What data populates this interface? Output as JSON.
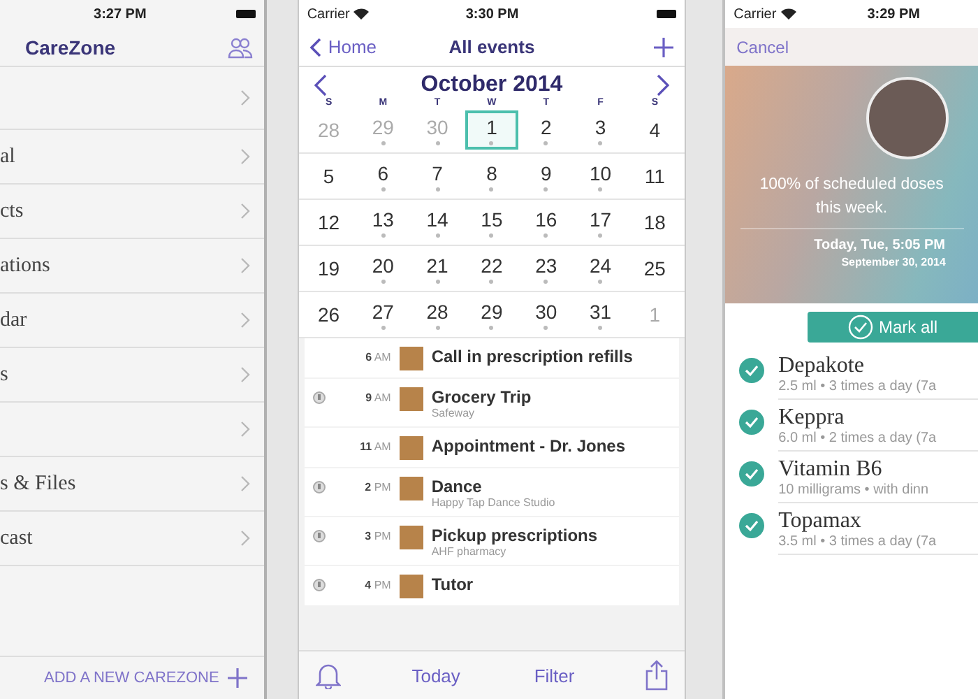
{
  "menu_screen": {
    "status_bar": {
      "time": "3:27 PM"
    },
    "title": "CareZone",
    "items": [
      {
        "chevron": true
      },
      {
        "label": "al",
        "chevron": true
      },
      {
        "label": "cts",
        "chevron": true
      },
      {
        "label": "ations",
        "chevron": true
      },
      {
        "label": "dar",
        "chevron": true
      },
      {
        "label": "s",
        "chevron": true
      },
      {
        "chevron": true
      },
      {
        "label": "s & Files",
        "chevron": true
      },
      {
        "label": "cast",
        "chevron": true
      }
    ],
    "add_button": "ADD A NEW CAREZONE"
  },
  "calendar_screen": {
    "status_bar": {
      "carrier": "Carrier",
      "time": "3:30 PM"
    },
    "back": "Home",
    "title": "All events",
    "month": "October 2014",
    "weekdays": [
      "S",
      "M",
      "T",
      "W",
      "T",
      "F",
      "S"
    ],
    "weeks": [
      [
        {
          "day": "28",
          "in_month": false,
          "dot": false,
          "selected": false
        },
        {
          "day": "29",
          "in_month": false,
          "dot": true,
          "selected": false
        },
        {
          "day": "30",
          "in_month": false,
          "dot": true,
          "selected": false
        },
        {
          "day": "1",
          "in_month": true,
          "dot": true,
          "selected": true
        },
        {
          "day": "2",
          "in_month": true,
          "dot": true,
          "selected": false
        },
        {
          "day": "3",
          "in_month": true,
          "dot": true,
          "selected": false
        },
        {
          "day": "4",
          "in_month": true,
          "dot": false,
          "selected": false
        }
      ],
      [
        {
          "day": "5",
          "in_month": true,
          "dot": false,
          "selected": false
        },
        {
          "day": "6",
          "in_month": true,
          "dot": true,
          "selected": false
        },
        {
          "day": "7",
          "in_month": true,
          "dot": true,
          "selected": false
        },
        {
          "day": "8",
          "in_month": true,
          "dot": true,
          "selected": false
        },
        {
          "day": "9",
          "in_month": true,
          "dot": true,
          "selected": false
        },
        {
          "day": "10",
          "in_month": true,
          "dot": true,
          "selected": false
        },
        {
          "day": "11",
          "in_month": true,
          "dot": false,
          "selected": false
        }
      ],
      [
        {
          "day": "12",
          "in_month": true,
          "dot": false,
          "selected": false
        },
        {
          "day": "13",
          "in_month": true,
          "dot": true,
          "selected": false
        },
        {
          "day": "14",
          "in_month": true,
          "dot": true,
          "selected": false
        },
        {
          "day": "15",
          "in_month": true,
          "dot": true,
          "selected": false
        },
        {
          "day": "16",
          "in_month": true,
          "dot": true,
          "selected": false
        },
        {
          "day": "17",
          "in_month": true,
          "dot": true,
          "selected": false
        },
        {
          "day": "18",
          "in_month": true,
          "dot": false,
          "selected": false
        }
      ],
      [
        {
          "day": "19",
          "in_month": true,
          "dot": false,
          "selected": false
        },
        {
          "day": "20",
          "in_month": true,
          "dot": true,
          "selected": false
        },
        {
          "day": "21",
          "in_month": true,
          "dot": true,
          "selected": false
        },
        {
          "day": "22",
          "in_month": true,
          "dot": true,
          "selected": false
        },
        {
          "day": "23",
          "in_month": true,
          "dot": true,
          "selected": false
        },
        {
          "day": "24",
          "in_month": true,
          "dot": true,
          "selected": false
        },
        {
          "day": "25",
          "in_month": true,
          "dot": false,
          "selected": false
        }
      ],
      [
        {
          "day": "26",
          "in_month": true,
          "dot": false,
          "selected": false
        },
        {
          "day": "27",
          "in_month": true,
          "dot": true,
          "selected": false
        },
        {
          "day": "28",
          "in_month": true,
          "dot": true,
          "selected": false
        },
        {
          "day": "29",
          "in_month": true,
          "dot": true,
          "selected": false
        },
        {
          "day": "30",
          "in_month": true,
          "dot": true,
          "selected": false
        },
        {
          "day": "31",
          "in_month": true,
          "dot": true,
          "selected": false
        },
        {
          "day": "1",
          "in_month": false,
          "dot": false,
          "selected": false
        }
      ]
    ],
    "events": [
      {
        "hour": "6",
        "period": "AM",
        "title": "Call in prescription refills",
        "reminder": false
      },
      {
        "hour": "9",
        "period": "AM",
        "title": "Grocery Trip",
        "place": "Safeway",
        "reminder": true
      },
      {
        "hour": "11",
        "period": "AM",
        "title": "Appointment - Dr. Jones",
        "reminder": false
      },
      {
        "hour": "2",
        "period": "PM",
        "title": "Dance",
        "place": "Happy Tap Dance Studio",
        "reminder": true
      },
      {
        "hour": "3",
        "period": "PM",
        "title": "Pickup prescriptions",
        "place": "AHF pharmacy",
        "reminder": true
      },
      {
        "hour": "4",
        "period": "PM",
        "title": "Tutor",
        "reminder": true
      }
    ],
    "toolbar": {
      "today": "Today",
      "filter": "Filter"
    }
  },
  "medication_screen": {
    "status_bar": {
      "carrier": "Carrier",
      "time": "3:29 PM"
    },
    "cancel": "Cancel",
    "summary": "100% of scheduled doses this week.",
    "when": "Today, Tue, 5:05 PM",
    "date": "September 30, 2014",
    "mark_all": "Mark all",
    "medications": [
      {
        "name": "Depakote",
        "detail": "2.5 ml • 3 times a day (7a",
        "checked": true
      },
      {
        "name": "Keppra",
        "detail": "6.0 ml • 2 times a day (7a",
        "checked": true
      },
      {
        "name": "Vitamin B6",
        "detail": "10 milligrams • with dinn",
        "checked": true
      },
      {
        "name": "Topamax",
        "detail": "3.5 ml • 3 times a day (7a",
        "checked": true
      }
    ]
  }
}
